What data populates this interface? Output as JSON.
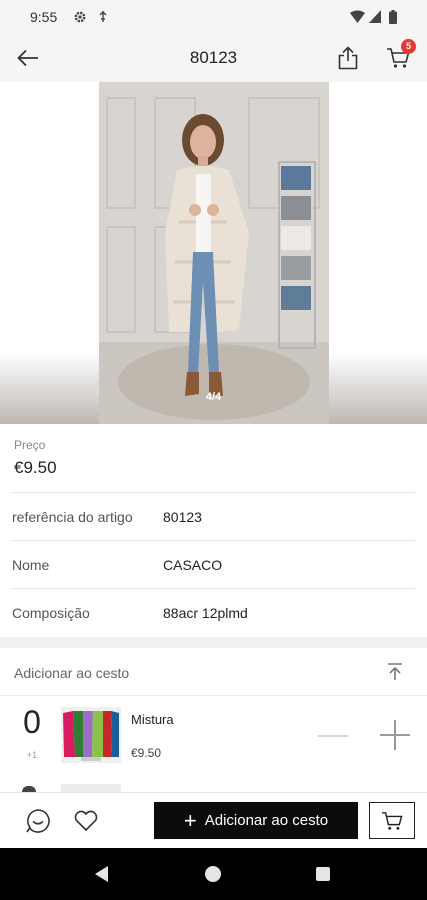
{
  "status_bar": {
    "time": "9:55"
  },
  "app_bar": {
    "title": "80123",
    "cart_badge_count": "5"
  },
  "gallery": {
    "counter": "4/4"
  },
  "product": {
    "price_label": "Preço",
    "price": "€9.50",
    "rows": [
      {
        "label": "referência do artigo",
        "value": "80123"
      },
      {
        "label": "Nome",
        "value": "CASACO"
      },
      {
        "label": "Composição",
        "value": "88acr 12plmd"
      }
    ]
  },
  "cart_section": {
    "header": "Adicionar ao cesto",
    "item": {
      "quantity": "0",
      "quantity_sub": "+1",
      "name": "Mistura",
      "price": "€9.50"
    }
  },
  "bottom_bar": {
    "add_label": "Adicionar ao cesto"
  },
  "colors": {
    "accent": "#0c0c0c",
    "badge": "#e53935"
  }
}
